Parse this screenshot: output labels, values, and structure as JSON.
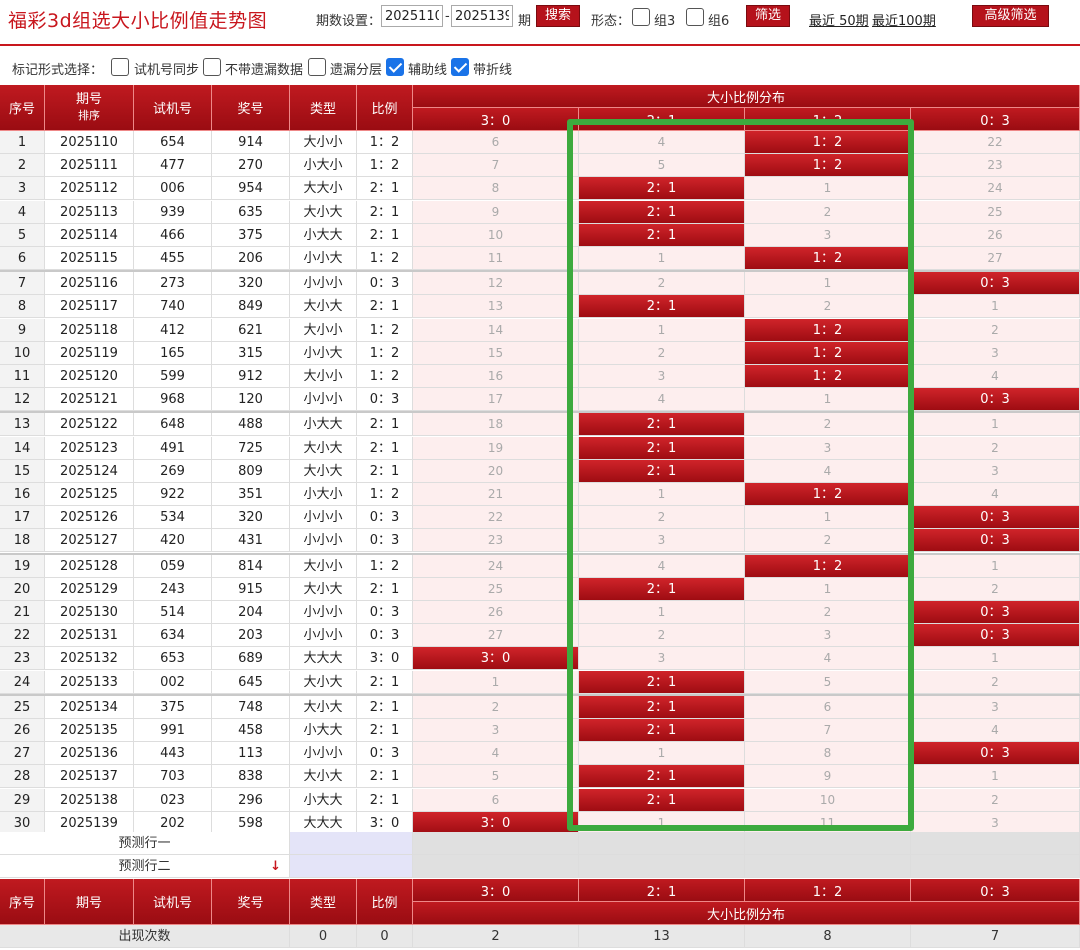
{
  "header": {
    "title": "福彩3d组选大小比例值走势图",
    "period_label": "期数设置：",
    "from": "2025110",
    "dash": "-",
    "to": "2025139",
    "period_unit": "期",
    "search_label": "搜索",
    "shape_label": "形态：",
    "group3_label": "组3",
    "group6_label": "组6",
    "filter_label": "筛选",
    "recent50_label": "最近 50期",
    "recent100_label": "最近100期",
    "advanced_label": "高级筛选"
  },
  "options": {
    "label": "标记形式选择：",
    "items": [
      {
        "label": "试机号同步",
        "checked": false
      },
      {
        "label": "不带遗漏数据",
        "checked": false
      },
      {
        "label": "遗漏分层",
        "checked": false
      },
      {
        "label": "辅助线",
        "checked": true
      },
      {
        "label": "带折线",
        "checked": true
      }
    ]
  },
  "table": {
    "headers": {
      "seq": "序号",
      "period": "期号",
      "sort": "排序",
      "trial": "试机号",
      "prize": "奖号",
      "type": "类型",
      "ratio": "比例",
      "dist": "大小比例分布"
    },
    "ratio_cols": [
      "3：0",
      "2：1",
      "1：2",
      "0：3"
    ],
    "rows": [
      {
        "seq": "1",
        "period": "2025110",
        "trial": "654",
        "prize": "914",
        "type": "大小小",
        "ratio": "1：2",
        "cells": [
          "6",
          "4",
          "1：2",
          "22"
        ],
        "hit": 2
      },
      {
        "seq": "2",
        "period": "2025111",
        "trial": "477",
        "prize": "270",
        "type": "小大小",
        "ratio": "1：2",
        "cells": [
          "7",
          "5",
          "1：2",
          "23"
        ],
        "hit": 2
      },
      {
        "seq": "3",
        "period": "2025112",
        "trial": "006",
        "prize": "954",
        "type": "大大小",
        "ratio": "2：1",
        "cells": [
          "8",
          "2：1",
          "1",
          "24"
        ],
        "hit": 1
      },
      {
        "seq": "4",
        "period": "2025113",
        "trial": "939",
        "prize": "635",
        "type": "大小大",
        "ratio": "2：1",
        "cells": [
          "9",
          "2：1",
          "2",
          "25"
        ],
        "hit": 1
      },
      {
        "seq": "5",
        "period": "2025114",
        "trial": "466",
        "prize": "375",
        "type": "小大大",
        "ratio": "2：1",
        "cells": [
          "10",
          "2：1",
          "3",
          "26"
        ],
        "hit": 1
      },
      {
        "seq": "6",
        "period": "2025115",
        "trial": "455",
        "prize": "206",
        "type": "小小大",
        "ratio": "1：2",
        "cells": [
          "11",
          "1",
          "1：2",
          "27"
        ],
        "hit": 2
      },
      {
        "seq": "7",
        "period": "2025116",
        "trial": "273",
        "prize": "320",
        "type": "小小小",
        "ratio": "0：3",
        "cells": [
          "12",
          "2",
          "1",
          "0：3"
        ],
        "hit": 3
      },
      {
        "seq": "8",
        "period": "2025117",
        "trial": "740",
        "prize": "849",
        "type": "大小大",
        "ratio": "2：1",
        "cells": [
          "13",
          "2：1",
          "2",
          "1"
        ],
        "hit": 1
      },
      {
        "seq": "9",
        "period": "2025118",
        "trial": "412",
        "prize": "621",
        "type": "大小小",
        "ratio": "1：2",
        "cells": [
          "14",
          "1",
          "1：2",
          "2"
        ],
        "hit": 2
      },
      {
        "seq": "10",
        "period": "2025119",
        "trial": "165",
        "prize": "315",
        "type": "小小大",
        "ratio": "1：2",
        "cells": [
          "15",
          "2",
          "1：2",
          "3"
        ],
        "hit": 2
      },
      {
        "seq": "11",
        "period": "2025120",
        "trial": "599",
        "prize": "912",
        "type": "大小小",
        "ratio": "1：2",
        "cells": [
          "16",
          "3",
          "1：2",
          "4"
        ],
        "hit": 2
      },
      {
        "seq": "12",
        "period": "2025121",
        "trial": "968",
        "prize": "120",
        "type": "小小小",
        "ratio": "0：3",
        "cells": [
          "17",
          "4",
          "1",
          "0：3"
        ],
        "hit": 3
      },
      {
        "seq": "13",
        "period": "2025122",
        "trial": "648",
        "prize": "488",
        "type": "小大大",
        "ratio": "2：1",
        "cells": [
          "18",
          "2：1",
          "2",
          "1"
        ],
        "hit": 1
      },
      {
        "seq": "14",
        "period": "2025123",
        "trial": "491",
        "prize": "725",
        "type": "大小大",
        "ratio": "2：1",
        "cells": [
          "19",
          "2：1",
          "3",
          "2"
        ],
        "hit": 1
      },
      {
        "seq": "15",
        "period": "2025124",
        "trial": "269",
        "prize": "809",
        "type": "大小大",
        "ratio": "2：1",
        "cells": [
          "20",
          "2：1",
          "4",
          "3"
        ],
        "hit": 1
      },
      {
        "seq": "16",
        "period": "2025125",
        "trial": "922",
        "prize": "351",
        "type": "小大小",
        "ratio": "1：2",
        "cells": [
          "21",
          "1",
          "1：2",
          "4"
        ],
        "hit": 2
      },
      {
        "seq": "17",
        "period": "2025126",
        "trial": "534",
        "prize": "320",
        "type": "小小小",
        "ratio": "0：3",
        "cells": [
          "22",
          "2",
          "1",
          "0：3"
        ],
        "hit": 3
      },
      {
        "seq": "18",
        "period": "2025127",
        "trial": "420",
        "prize": "431",
        "type": "小小小",
        "ratio": "0：3",
        "cells": [
          "23",
          "3",
          "2",
          "0：3"
        ],
        "hit": 3
      },
      {
        "seq": "19",
        "period": "2025128",
        "trial": "059",
        "prize": "814",
        "type": "大小小",
        "ratio": "1：2",
        "cells": [
          "24",
          "4",
          "1：2",
          "1"
        ],
        "hit": 2
      },
      {
        "seq": "20",
        "period": "2025129",
        "trial": "243",
        "prize": "915",
        "type": "大小大",
        "ratio": "2：1",
        "cells": [
          "25",
          "2：1",
          "1",
          "2"
        ],
        "hit": 1
      },
      {
        "seq": "21",
        "period": "2025130",
        "trial": "514",
        "prize": "204",
        "type": "小小小",
        "ratio": "0：3",
        "cells": [
          "26",
          "1",
          "2",
          "0：3"
        ],
        "hit": 3
      },
      {
        "seq": "22",
        "period": "2025131",
        "trial": "634",
        "prize": "203",
        "type": "小小小",
        "ratio": "0：3",
        "cells": [
          "27",
          "2",
          "3",
          "0：3"
        ],
        "hit": 3
      },
      {
        "seq": "23",
        "period": "2025132",
        "trial": "653",
        "prize": "689",
        "type": "大大大",
        "ratio": "3：0",
        "cells": [
          "3：0",
          "3",
          "4",
          "1"
        ],
        "hit": 0
      },
      {
        "seq": "24",
        "period": "2025133",
        "trial": "002",
        "prize": "645",
        "type": "大小大",
        "ratio": "2：1",
        "cells": [
          "1",
          "2：1",
          "5",
          "2"
        ],
        "hit": 1
      },
      {
        "seq": "25",
        "period": "2025134",
        "trial": "375",
        "prize": "748",
        "type": "大小大",
        "ratio": "2：1",
        "cells": [
          "2",
          "2：1",
          "6",
          "3"
        ],
        "hit": 1
      },
      {
        "seq": "26",
        "period": "2025135",
        "trial": "991",
        "prize": "458",
        "type": "小大大",
        "ratio": "2：1",
        "cells": [
          "3",
          "2：1",
          "7",
          "4"
        ],
        "hit": 1
      },
      {
        "seq": "27",
        "period": "2025136",
        "trial": "443",
        "prize": "113",
        "type": "小小小",
        "ratio": "0：3",
        "cells": [
          "4",
          "1",
          "8",
          "0：3"
        ],
        "hit": 3
      },
      {
        "seq": "28",
        "period": "2025137",
        "trial": "703",
        "prize": "838",
        "type": "大小大",
        "ratio": "2：1",
        "cells": [
          "5",
          "2：1",
          "9",
          "1"
        ],
        "hit": 1
      },
      {
        "seq": "29",
        "period": "2025138",
        "trial": "023",
        "prize": "296",
        "type": "小大大",
        "ratio": "2：1",
        "cells": [
          "6",
          "2：1",
          "10",
          "2"
        ],
        "hit": 1
      },
      {
        "seq": "30",
        "period": "2025139",
        "trial": "202",
        "prize": "598",
        "type": "大大大",
        "ratio": "3：0",
        "cells": [
          "3：0",
          "1",
          "11",
          "3"
        ],
        "hit": 0
      }
    ],
    "predict1": "预测行一",
    "predict2": "预测行二",
    "predict_arrow": "↓",
    "footer_counts_label": "出现次数",
    "footer_type": "0",
    "footer_ratio": "0",
    "footer_counts": [
      "2",
      "13",
      "8",
      "7"
    ]
  },
  "colors": {
    "brand_red": "#c8161d",
    "highlight_green": "#3daa3e",
    "checkbox_blue": "#1a73e8"
  }
}
